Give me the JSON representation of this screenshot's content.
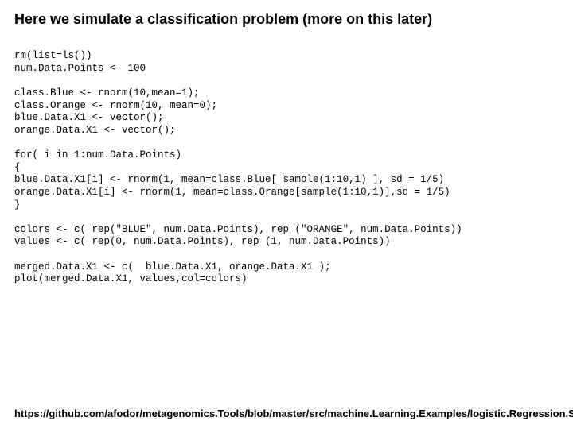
{
  "title": "Here we simulate a classification problem (more on this later)",
  "code": {
    "l01": "rm(list=ls())",
    "l02": "num.Data.Points <- 100",
    "l03": "",
    "l04": "class.Blue <- rnorm(10,mean=1);",
    "l05": "class.Orange <- rnorm(10, mean=0);",
    "l06": "blue.Data.X1 <- vector();",
    "l07": "orange.Data.X1 <- vector();",
    "l08": "",
    "l09": "for( i in 1:num.Data.Points)",
    "l10": "{",
    "l11": "blue.Data.X1[i] <- rnorm(1, mean=class.Blue[ sample(1:10,1) ], sd = 1/5)",
    "l12": "orange.Data.X1[i] <- rnorm(1, mean=class.Orange[sample(1:10,1)],sd = 1/5)",
    "l13": "}",
    "l14": "",
    "l15": "colors <- c( rep(\"BLUE\", num.Data.Points), rep (\"ORANGE\", num.Data.Points))",
    "l16": "values <- c( rep(0, num.Data.Points), rep (1, num.Data.Points))",
    "l17": "",
    "l18": "merged.Data.X1 <- c(  blue.Data.X1, orange.Data.X1 );",
    "l19": "plot(merged.Data.X1, values,col=colors)"
  },
  "footer": "https://github.com/afodor/metagenomics.Tools/blob/master/src/machine.Learning.Examples/logistic.Regression.Sims.txt"
}
